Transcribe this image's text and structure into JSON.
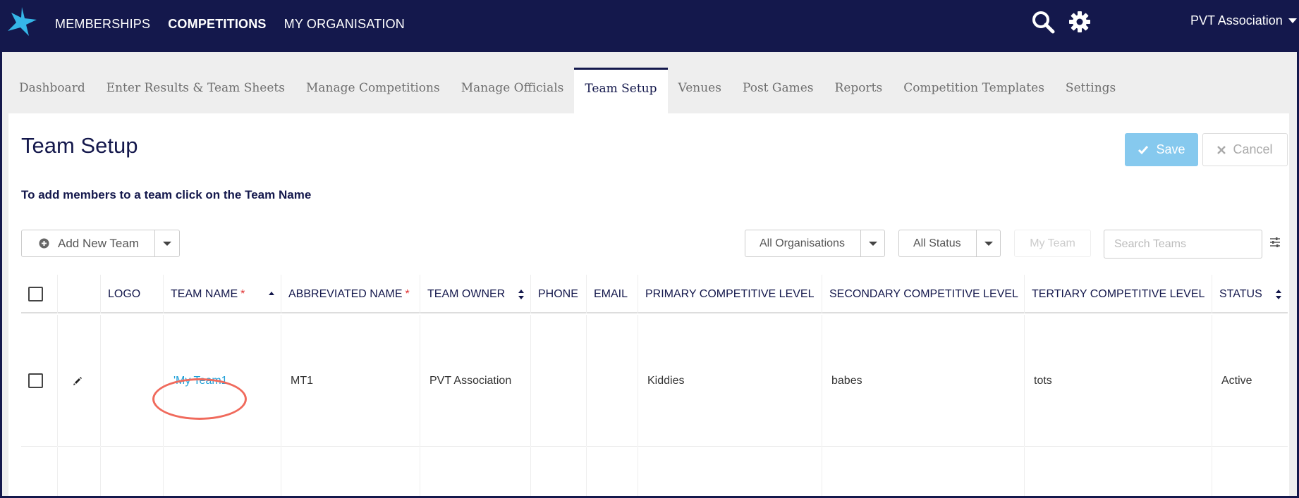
{
  "topnav": {
    "items": [
      {
        "label": "MEMBERSHIPS",
        "active": false
      },
      {
        "label": "COMPETITIONS",
        "active": true
      },
      {
        "label": "MY ORGANISATION",
        "active": false
      }
    ],
    "org_name": "PVT Association",
    "icons": [
      "logo-star-icon",
      "search-icon",
      "gear-icon",
      "caret-down-icon"
    ]
  },
  "tabs": [
    {
      "label": "Dashboard"
    },
    {
      "label": "Enter Results & Team Sheets"
    },
    {
      "label": "Manage Competitions"
    },
    {
      "label": "Manage Officials"
    },
    {
      "label": "Team Setup",
      "active": true
    },
    {
      "label": "Venues"
    },
    {
      "label": "Post Games"
    },
    {
      "label": "Reports"
    },
    {
      "label": "Competition Templates"
    },
    {
      "label": "Settings"
    }
  ],
  "page": {
    "title": "Team Setup",
    "save_label": "Save",
    "cancel_label": "Cancel",
    "hint": "To add members to a team click on the Team Name"
  },
  "toolbar": {
    "add_team_label": "Add New Team",
    "org_filter": "All Organisations",
    "status_filter": "All Status",
    "my_team_label": "My Team",
    "search_placeholder": "Search Teams"
  },
  "table": {
    "columns": [
      {
        "label": "LOGO"
      },
      {
        "label": "TEAM NAME",
        "required": "*"
      },
      {
        "label": "ABBREVIATED NAME",
        "required": "*"
      },
      {
        "label": "TEAM OWNER"
      },
      {
        "label": "PHONE"
      },
      {
        "label": "EMAIL"
      },
      {
        "label": "PRIMARY COMPETITIVE LEVEL"
      },
      {
        "label": "SECONDARY COMPETITIVE LEVEL"
      },
      {
        "label": "TERTIARY COMPETITIVE LEVEL"
      },
      {
        "label": "STATUS"
      }
    ],
    "rows": [
      {
        "logo": "",
        "team_name": "'My Team1",
        "abbreviated_name": "MT1",
        "team_owner": "PVT Association",
        "phone": "",
        "email": "",
        "primary_level": "Kiddies",
        "secondary_level": "babes",
        "tertiary_level": "tots",
        "status": "Active"
      }
    ]
  },
  "colors": {
    "nav_bg": "#14184c",
    "accent_link": "#1fa0d8",
    "save_bg": "#86c9ee",
    "highlight_circle": "#f06a5c",
    "required": "#e03030"
  }
}
